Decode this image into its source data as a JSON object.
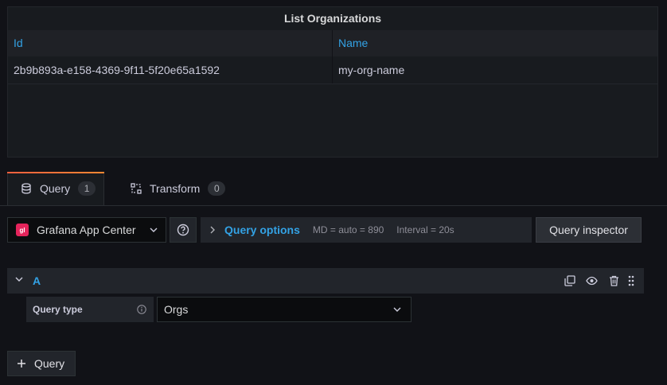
{
  "panel": {
    "title": "List Organizations",
    "columns": [
      "Id",
      "Name"
    ],
    "rows": [
      [
        "2b9b893a-e158-4369-9f11-5f20e65a1592",
        "my-org-name"
      ]
    ]
  },
  "tabs": [
    {
      "label": "Query",
      "count": "1",
      "active": true,
      "icon": "database-icon"
    },
    {
      "label": "Transform",
      "count": "0",
      "active": false,
      "icon": "transform-icon"
    }
  ],
  "toolbar": {
    "datasource": "Grafana App Center",
    "datasource_logo_text": "gl",
    "query_options_label": "Query options",
    "md_info": "MD = auto = 890",
    "interval_info": "Interval = 20s",
    "inspector_label": "Query inspector"
  },
  "query_row": {
    "ref_id": "A",
    "query_type_label": "Query type",
    "query_type_value": "Orgs"
  },
  "add_query_label": "Query",
  "colors": {
    "accent_blue": "#33a2e5",
    "tab_gradient_start": "#f55f3e",
    "tab_gradient_end": "#ff8833",
    "plugin_logo": "#e4245b"
  }
}
